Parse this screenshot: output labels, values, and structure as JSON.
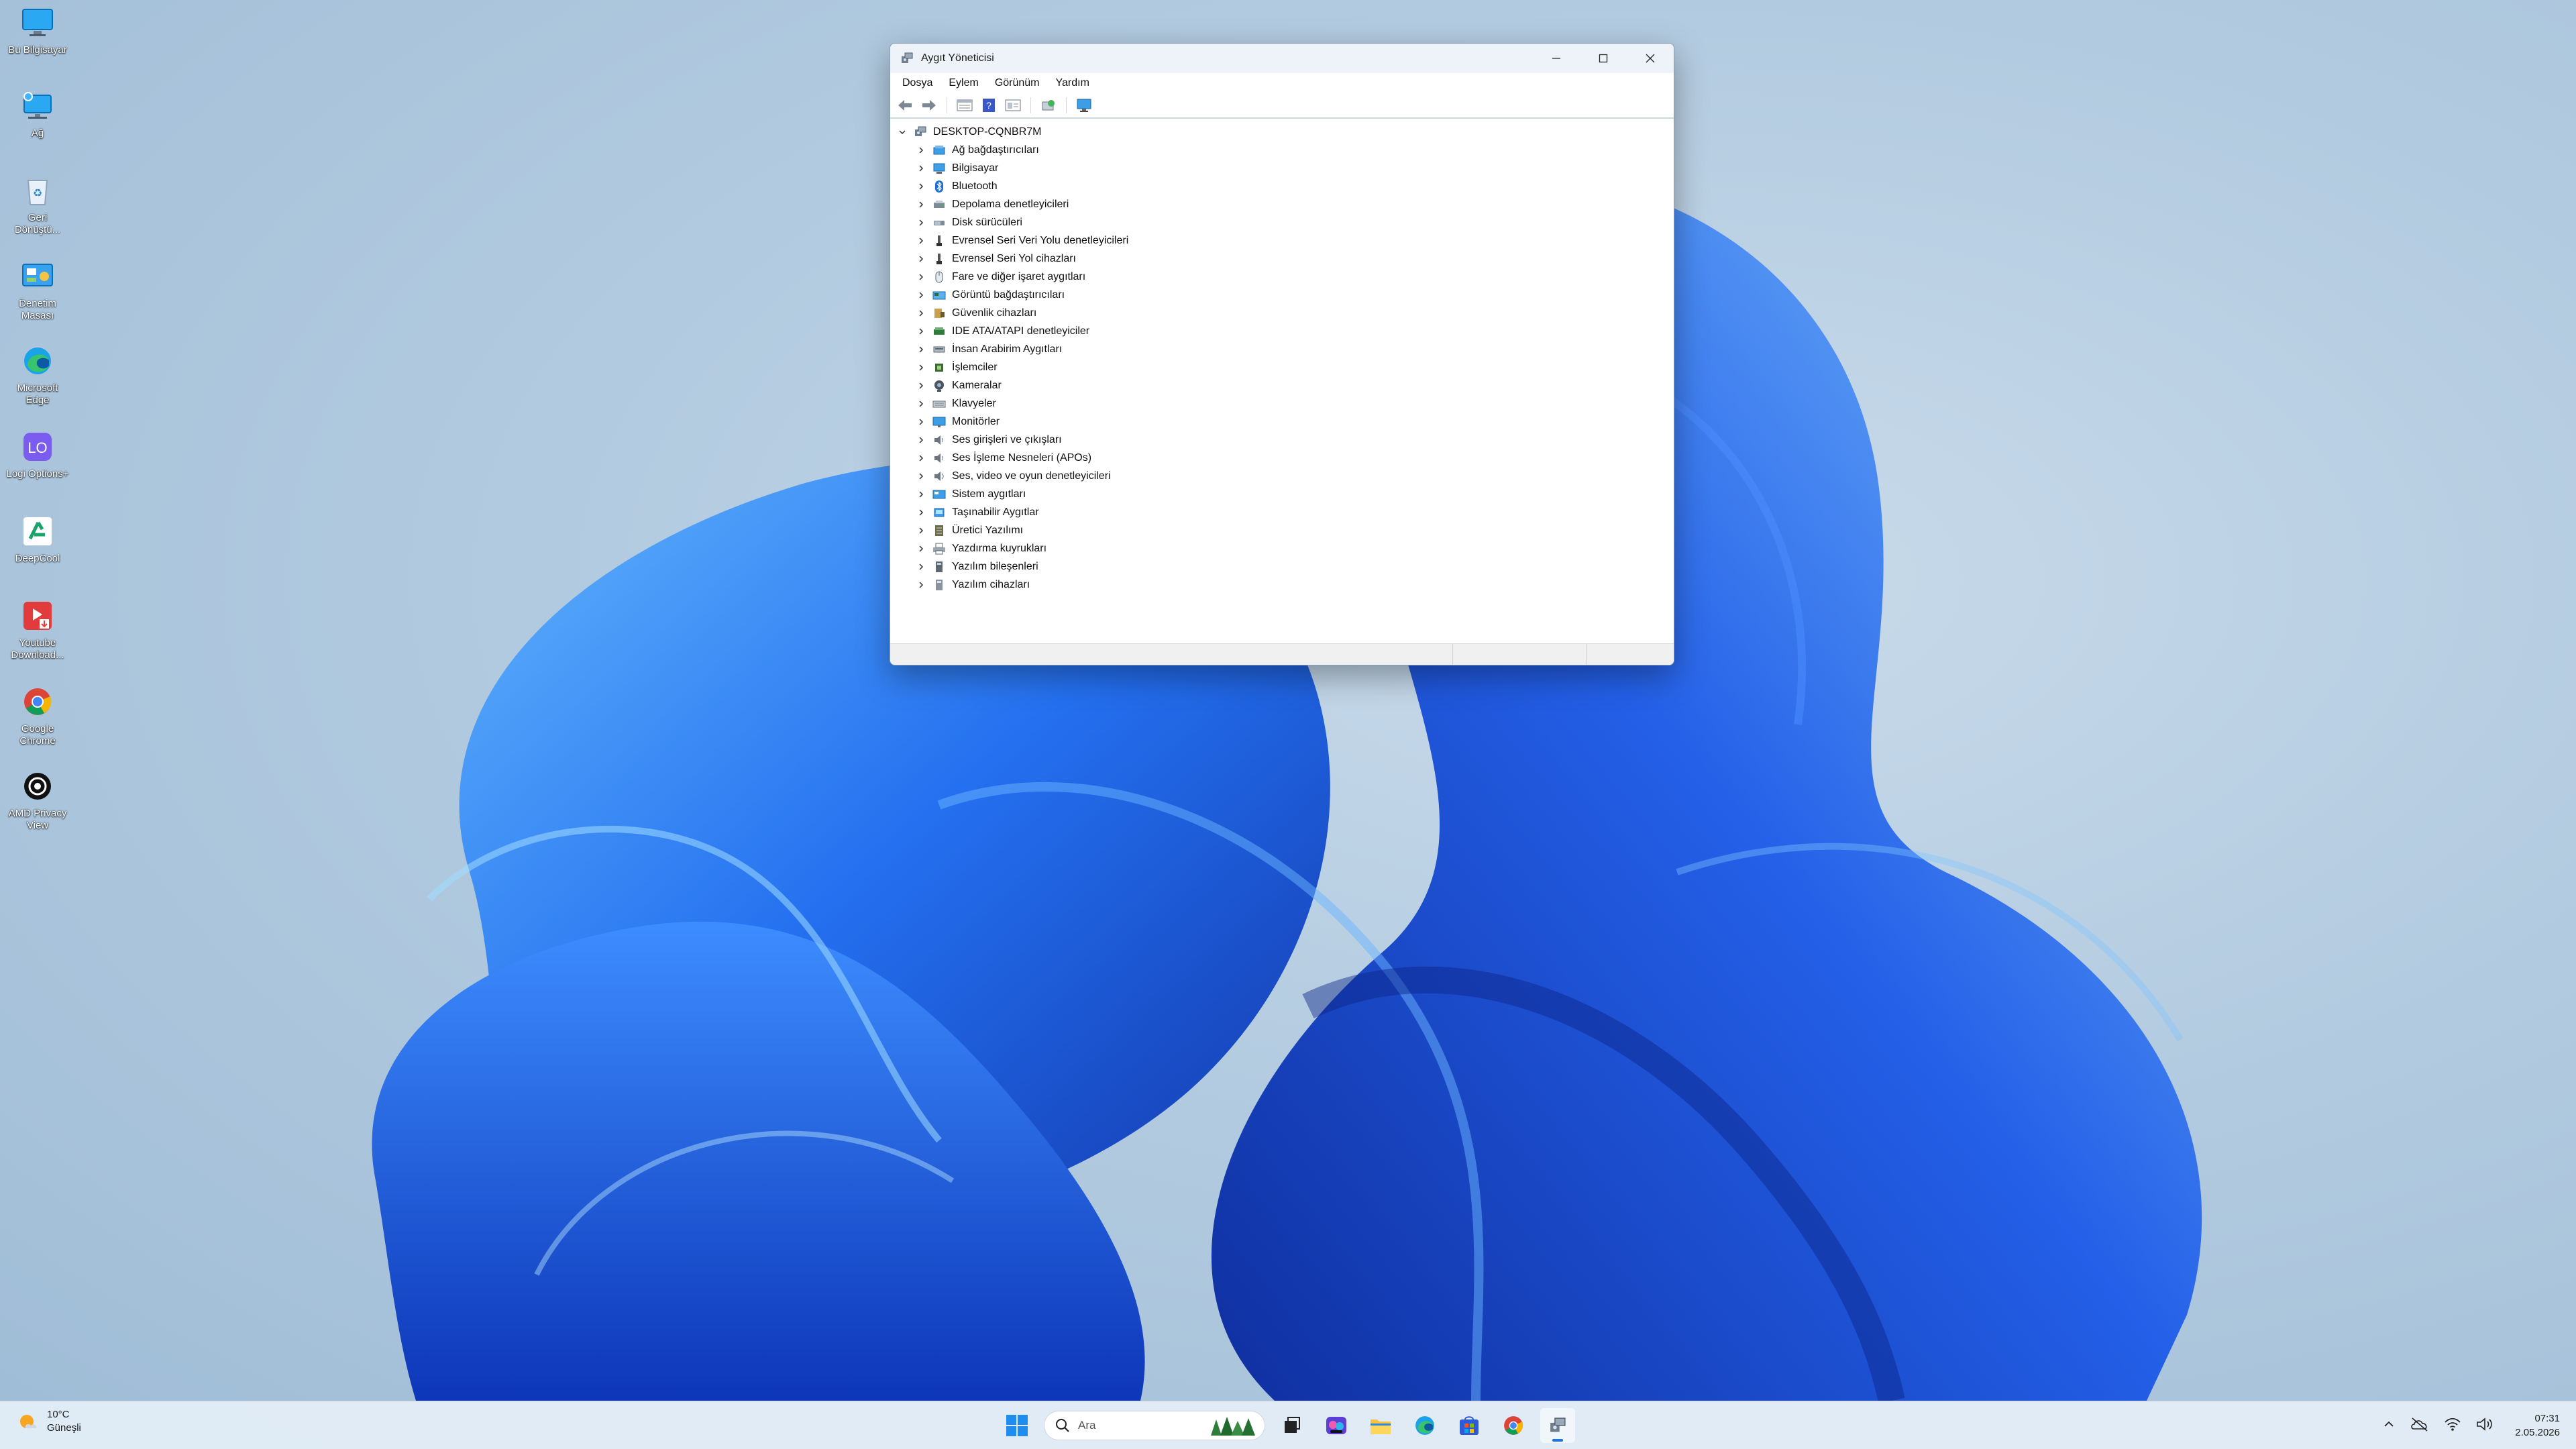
{
  "desktop": {
    "icons": [
      {
        "label": "Bu Bilgisayar",
        "icon": "monitor-icon"
      },
      {
        "label": "Ağ",
        "icon": "network-icon"
      },
      {
        "label": "Geri Dönüştü...",
        "icon": "recycle-bin-icon"
      },
      {
        "label": "Denetim Masası",
        "icon": "control-panel-icon"
      },
      {
        "label": "Microsoft Edge",
        "icon": "edge-icon"
      },
      {
        "label": "Logi Options+",
        "icon": "logi-icon"
      },
      {
        "label": "DeepCool",
        "icon": "deepcool-icon"
      },
      {
        "label": "Youtube Download...",
        "icon": "youtube-downloader-icon"
      },
      {
        "label": "Google Chrome",
        "icon": "chrome-icon"
      },
      {
        "label": "AMD Privacy View",
        "icon": "amd-privacy-icon"
      }
    ]
  },
  "window": {
    "title": "Aygıt Yöneticisi",
    "menu": [
      "Dosya",
      "Eylem",
      "Görünüm",
      "Yardım"
    ],
    "toolbar": [
      "back-icon",
      "forward-icon",
      "properties-view-icon",
      "help-icon",
      "details-view-icon",
      "refresh-scan-icon",
      "monitor-scan-icon"
    ],
    "tree": {
      "root": "DESKTOP-CQNBR7M",
      "children": [
        {
          "label": "Ağ bağdaştırıcıları",
          "icon": "network-adapter-icon"
        },
        {
          "label": "Bilgisayar",
          "icon": "computer-icon"
        },
        {
          "label": "Bluetooth",
          "icon": "bluetooth-icon"
        },
        {
          "label": "Depolama denetleyicileri",
          "icon": "storage-controller-icon"
        },
        {
          "label": "Disk sürücüleri",
          "icon": "disk-drive-icon"
        },
        {
          "label": "Evrensel Seri Veri Yolu denetleyicileri",
          "icon": "usb-icon"
        },
        {
          "label": "Evrensel Seri Yol cihazları",
          "icon": "usb-device-icon"
        },
        {
          "label": "Fare ve diğer işaret aygıtları",
          "icon": "mouse-icon"
        },
        {
          "label": "Görüntü bağdaştırıcıları",
          "icon": "display-adapter-icon"
        },
        {
          "label": "Güvenlik cihazları",
          "icon": "security-device-icon"
        },
        {
          "label": "IDE ATA/ATAPI denetleyiciler",
          "icon": "ide-controller-icon"
        },
        {
          "label": "İnsan Arabirim Aygıtları",
          "icon": "hid-icon"
        },
        {
          "label": "İşlemciler",
          "icon": "processor-icon"
        },
        {
          "label": "Kameralar",
          "icon": "camera-icon"
        },
        {
          "label": "Klavyeler",
          "icon": "keyboard-icon"
        },
        {
          "label": "Monitörler",
          "icon": "monitor-icon"
        },
        {
          "label": "Ses girişleri ve çıkışları",
          "icon": "audio-io-icon"
        },
        {
          "label": "Ses İşleme Nesneleri (APOs)",
          "icon": "audio-processing-icon"
        },
        {
          "label": "Ses, video ve oyun denetleyicileri",
          "icon": "sound-video-icon"
        },
        {
          "label": "Sistem aygıtları",
          "icon": "system-device-icon"
        },
        {
          "label": "Taşınabilir Aygıtlar",
          "icon": "portable-device-icon"
        },
        {
          "label": "Üretici Yazılımı",
          "icon": "firmware-icon"
        },
        {
          "label": "Yazdırma kuyrukları",
          "icon": "printer-icon"
        },
        {
          "label": "Yazılım bileşenleri",
          "icon": "software-component-icon"
        },
        {
          "label": "Yazılım cihazları",
          "icon": "software-device-icon"
        }
      ]
    }
  },
  "taskbar": {
    "weather": {
      "temp": "10°C",
      "condition": "Güneşli"
    },
    "search_placeholder": "Ara",
    "apps": [
      "start-icon",
      "search",
      "task-view-icon",
      "copilot-app-icon",
      "file-explorer-icon",
      "edge-icon",
      "store-icon",
      "chrome-icon",
      "device-manager-icon"
    ],
    "tray": [
      "chevron-up-icon",
      "onedrive-icon",
      "wifi-icon",
      "volume-icon"
    ],
    "time": "07:31",
    "date": "2.05.2026"
  },
  "colors": {
    "accent": "#0067c0",
    "wallpaper_blue": "#1f5ce8",
    "taskbar": "#e2ecf6"
  }
}
